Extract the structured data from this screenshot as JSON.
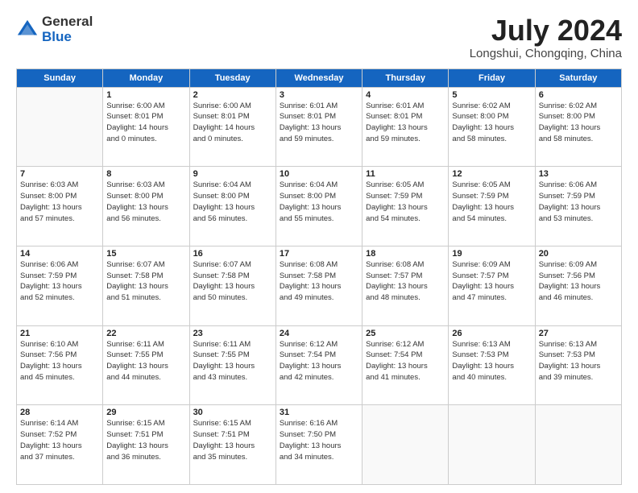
{
  "header": {
    "logo_general": "General",
    "logo_blue": "Blue",
    "month_title": "July 2024",
    "location": "Longshui, Chongqing, China"
  },
  "weekdays": [
    "Sunday",
    "Monday",
    "Tuesday",
    "Wednesday",
    "Thursday",
    "Friday",
    "Saturday"
  ],
  "weeks": [
    [
      {
        "day": "",
        "info": ""
      },
      {
        "day": "1",
        "info": "Sunrise: 6:00 AM\nSunset: 8:01 PM\nDaylight: 14 hours\nand 0 minutes."
      },
      {
        "day": "2",
        "info": "Sunrise: 6:00 AM\nSunset: 8:01 PM\nDaylight: 14 hours\nand 0 minutes."
      },
      {
        "day": "3",
        "info": "Sunrise: 6:01 AM\nSunset: 8:01 PM\nDaylight: 13 hours\nand 59 minutes."
      },
      {
        "day": "4",
        "info": "Sunrise: 6:01 AM\nSunset: 8:01 PM\nDaylight: 13 hours\nand 59 minutes."
      },
      {
        "day": "5",
        "info": "Sunrise: 6:02 AM\nSunset: 8:00 PM\nDaylight: 13 hours\nand 58 minutes."
      },
      {
        "day": "6",
        "info": "Sunrise: 6:02 AM\nSunset: 8:00 PM\nDaylight: 13 hours\nand 58 minutes."
      }
    ],
    [
      {
        "day": "7",
        "info": "Sunrise: 6:03 AM\nSunset: 8:00 PM\nDaylight: 13 hours\nand 57 minutes."
      },
      {
        "day": "8",
        "info": "Sunrise: 6:03 AM\nSunset: 8:00 PM\nDaylight: 13 hours\nand 56 minutes."
      },
      {
        "day": "9",
        "info": "Sunrise: 6:04 AM\nSunset: 8:00 PM\nDaylight: 13 hours\nand 56 minutes."
      },
      {
        "day": "10",
        "info": "Sunrise: 6:04 AM\nSunset: 8:00 PM\nDaylight: 13 hours\nand 55 minutes."
      },
      {
        "day": "11",
        "info": "Sunrise: 6:05 AM\nSunset: 7:59 PM\nDaylight: 13 hours\nand 54 minutes."
      },
      {
        "day": "12",
        "info": "Sunrise: 6:05 AM\nSunset: 7:59 PM\nDaylight: 13 hours\nand 54 minutes."
      },
      {
        "day": "13",
        "info": "Sunrise: 6:06 AM\nSunset: 7:59 PM\nDaylight: 13 hours\nand 53 minutes."
      }
    ],
    [
      {
        "day": "14",
        "info": "Sunrise: 6:06 AM\nSunset: 7:59 PM\nDaylight: 13 hours\nand 52 minutes."
      },
      {
        "day": "15",
        "info": "Sunrise: 6:07 AM\nSunset: 7:58 PM\nDaylight: 13 hours\nand 51 minutes."
      },
      {
        "day": "16",
        "info": "Sunrise: 6:07 AM\nSunset: 7:58 PM\nDaylight: 13 hours\nand 50 minutes."
      },
      {
        "day": "17",
        "info": "Sunrise: 6:08 AM\nSunset: 7:58 PM\nDaylight: 13 hours\nand 49 minutes."
      },
      {
        "day": "18",
        "info": "Sunrise: 6:08 AM\nSunset: 7:57 PM\nDaylight: 13 hours\nand 48 minutes."
      },
      {
        "day": "19",
        "info": "Sunrise: 6:09 AM\nSunset: 7:57 PM\nDaylight: 13 hours\nand 47 minutes."
      },
      {
        "day": "20",
        "info": "Sunrise: 6:09 AM\nSunset: 7:56 PM\nDaylight: 13 hours\nand 46 minutes."
      }
    ],
    [
      {
        "day": "21",
        "info": "Sunrise: 6:10 AM\nSunset: 7:56 PM\nDaylight: 13 hours\nand 45 minutes."
      },
      {
        "day": "22",
        "info": "Sunrise: 6:11 AM\nSunset: 7:55 PM\nDaylight: 13 hours\nand 44 minutes."
      },
      {
        "day": "23",
        "info": "Sunrise: 6:11 AM\nSunset: 7:55 PM\nDaylight: 13 hours\nand 43 minutes."
      },
      {
        "day": "24",
        "info": "Sunrise: 6:12 AM\nSunset: 7:54 PM\nDaylight: 13 hours\nand 42 minutes."
      },
      {
        "day": "25",
        "info": "Sunrise: 6:12 AM\nSunset: 7:54 PM\nDaylight: 13 hours\nand 41 minutes."
      },
      {
        "day": "26",
        "info": "Sunrise: 6:13 AM\nSunset: 7:53 PM\nDaylight: 13 hours\nand 40 minutes."
      },
      {
        "day": "27",
        "info": "Sunrise: 6:13 AM\nSunset: 7:53 PM\nDaylight: 13 hours\nand 39 minutes."
      }
    ],
    [
      {
        "day": "28",
        "info": "Sunrise: 6:14 AM\nSunset: 7:52 PM\nDaylight: 13 hours\nand 37 minutes."
      },
      {
        "day": "29",
        "info": "Sunrise: 6:15 AM\nSunset: 7:51 PM\nDaylight: 13 hours\nand 36 minutes."
      },
      {
        "day": "30",
        "info": "Sunrise: 6:15 AM\nSunset: 7:51 PM\nDaylight: 13 hours\nand 35 minutes."
      },
      {
        "day": "31",
        "info": "Sunrise: 6:16 AM\nSunset: 7:50 PM\nDaylight: 13 hours\nand 34 minutes."
      },
      {
        "day": "",
        "info": ""
      },
      {
        "day": "",
        "info": ""
      },
      {
        "day": "",
        "info": ""
      }
    ]
  ]
}
